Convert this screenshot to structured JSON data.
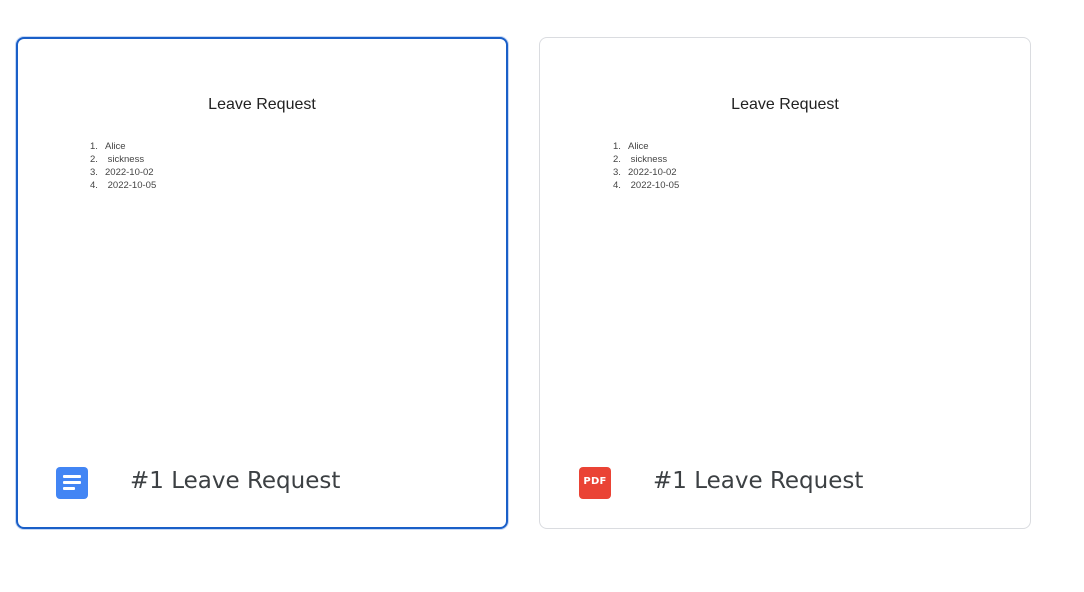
{
  "files": [
    {
      "name": "#1 Leave Request",
      "type_icon": "google-docs-icon",
      "selected": true,
      "preview": {
        "title": "Leave Request",
        "items": [
          {
            "num": "1.",
            "text": "Alice"
          },
          {
            "num": "2.",
            "text": " sickness"
          },
          {
            "num": "3.",
            "text": "2022-10-02"
          },
          {
            "num": "4.",
            "text": " 2022-10-05"
          }
        ]
      }
    },
    {
      "name": "#1 Leave Request",
      "type_icon": "pdf-icon",
      "icon_label": "PDF",
      "selected": false,
      "preview": {
        "title": "Leave Request",
        "items": [
          {
            "num": "1.",
            "text": "Alice"
          },
          {
            "num": "2.",
            "text": " sickness"
          },
          {
            "num": "3.",
            "text": "2022-10-02"
          },
          {
            "num": "4.",
            "text": " 2022-10-05"
          }
        ]
      }
    }
  ],
  "colors": {
    "selected_border": "#1a5fc8",
    "docs_icon": "#4285f4",
    "pdf_icon": "#ea4335"
  }
}
